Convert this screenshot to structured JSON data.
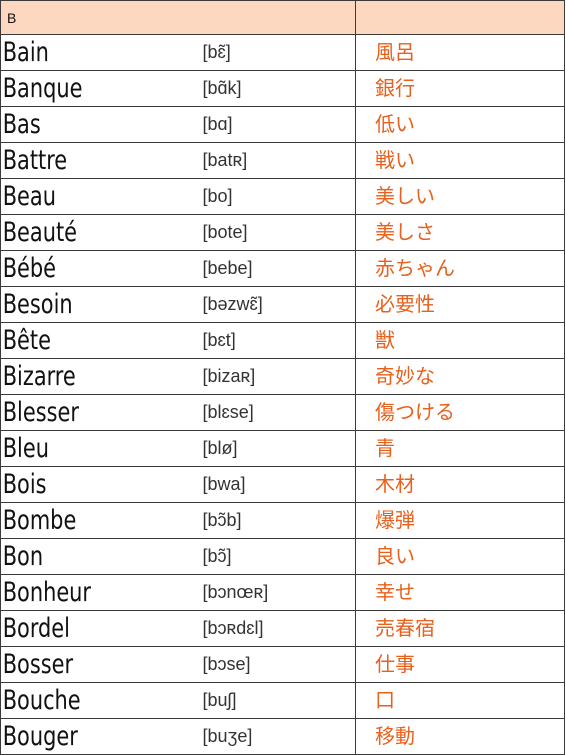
{
  "section": {
    "letter": "B",
    "extra": ""
  },
  "entries": [
    {
      "word": "Bain",
      "pron": "[bɛ̃]",
      "meaning": "風呂"
    },
    {
      "word": "Banque",
      "pron": "[bɑ̃k]",
      "meaning": "銀行"
    },
    {
      "word": "Bas",
      "pron": "[bɑ]",
      "meaning": "低い"
    },
    {
      "word": "Battre",
      "pron": "[batʀ]",
      "meaning": "戦い"
    },
    {
      "word": "Beau",
      "pron": "[bo]",
      "meaning": "美しい"
    },
    {
      "word": "Beauté",
      "pron": "[bote]",
      "meaning": "美しさ"
    },
    {
      "word": "Bébé",
      "pron": "[bebe]",
      "meaning": "赤ちゃん"
    },
    {
      "word": "Besoin",
      "pron": "[bəzwɛ̃]",
      "meaning": "必要性"
    },
    {
      "word": "Bête",
      "pron": "[bɛt]",
      "meaning": "獣"
    },
    {
      "word": "Bizarre",
      "pron": "[bizaʀ]",
      "meaning": "奇妙な"
    },
    {
      "word": "Blesser",
      "pron": "[blɛse]",
      "meaning": "傷つける"
    },
    {
      "word": "Bleu",
      "pron": "[blø]",
      "meaning": "青"
    },
    {
      "word": "Bois",
      "pron": "[bwa]",
      "meaning": "木材"
    },
    {
      "word": "Bombe",
      "pron": "[bɔ̃b]",
      "meaning": "爆弾"
    },
    {
      "word": "Bon",
      "pron": "[bɔ̃]",
      "meaning": "良い"
    },
    {
      "word": "Bonheur",
      "pron": "[bɔnœʀ]",
      "meaning": "幸せ"
    },
    {
      "word": "Bordel",
      "pron": "[bɔʀdɛl]",
      "meaning": "売春宿"
    },
    {
      "word": "Bosser",
      "pron": "[bɔse]",
      "meaning": "仕事"
    },
    {
      "word": "Bouche",
      "pron": "[buʃ]",
      "meaning": "口"
    },
    {
      "word": "Bouger",
      "pron": "[buʒe]",
      "meaning": "移動"
    }
  ]
}
